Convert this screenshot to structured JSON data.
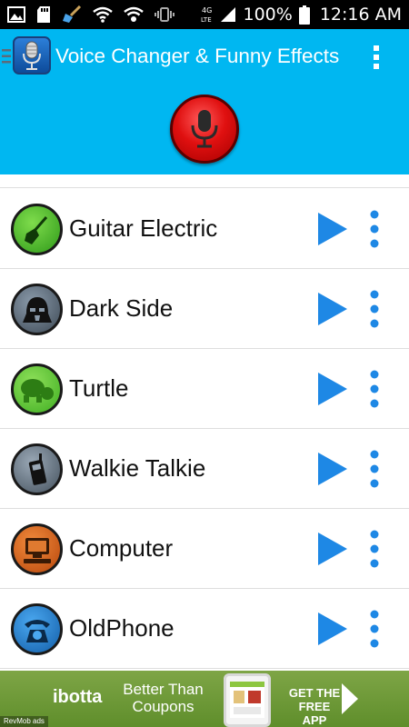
{
  "status_bar": {
    "icons": [
      "gallery-icon",
      "sd-card-icon",
      "broom-icon",
      "wifi-icon",
      "wifi-calling-icon",
      "vibrate-icon",
      "lte-icon",
      "signal-icon",
      "battery-icon"
    ],
    "network_label": "4G LTE",
    "battery_text": "100%",
    "time": "12:16 AM"
  },
  "app_bar": {
    "title": "Voice Changer & Funny Effects",
    "record_icon": "microphone-icon",
    "accent_color": "#00b7f1",
    "record_color": "#e01010"
  },
  "effects": [
    {
      "name": "Guitar Electric",
      "icon": "guitar-icon"
    },
    {
      "name": "Dark Side",
      "icon": "dark-helmet-icon"
    },
    {
      "name": "Turtle",
      "icon": "turtle-icon"
    },
    {
      "name": "Walkie Talkie",
      "icon": "walkie-talkie-icon"
    },
    {
      "name": "Computer",
      "icon": "computer-icon"
    },
    {
      "name": "OldPhone",
      "icon": "old-phone-icon"
    }
  ],
  "play_color": "#1e88e5",
  "ad": {
    "brand": "ibotta",
    "tagline": "Better Than Coupons",
    "cta": "GET THE FREE APP",
    "attribution": "RevMob ads"
  }
}
